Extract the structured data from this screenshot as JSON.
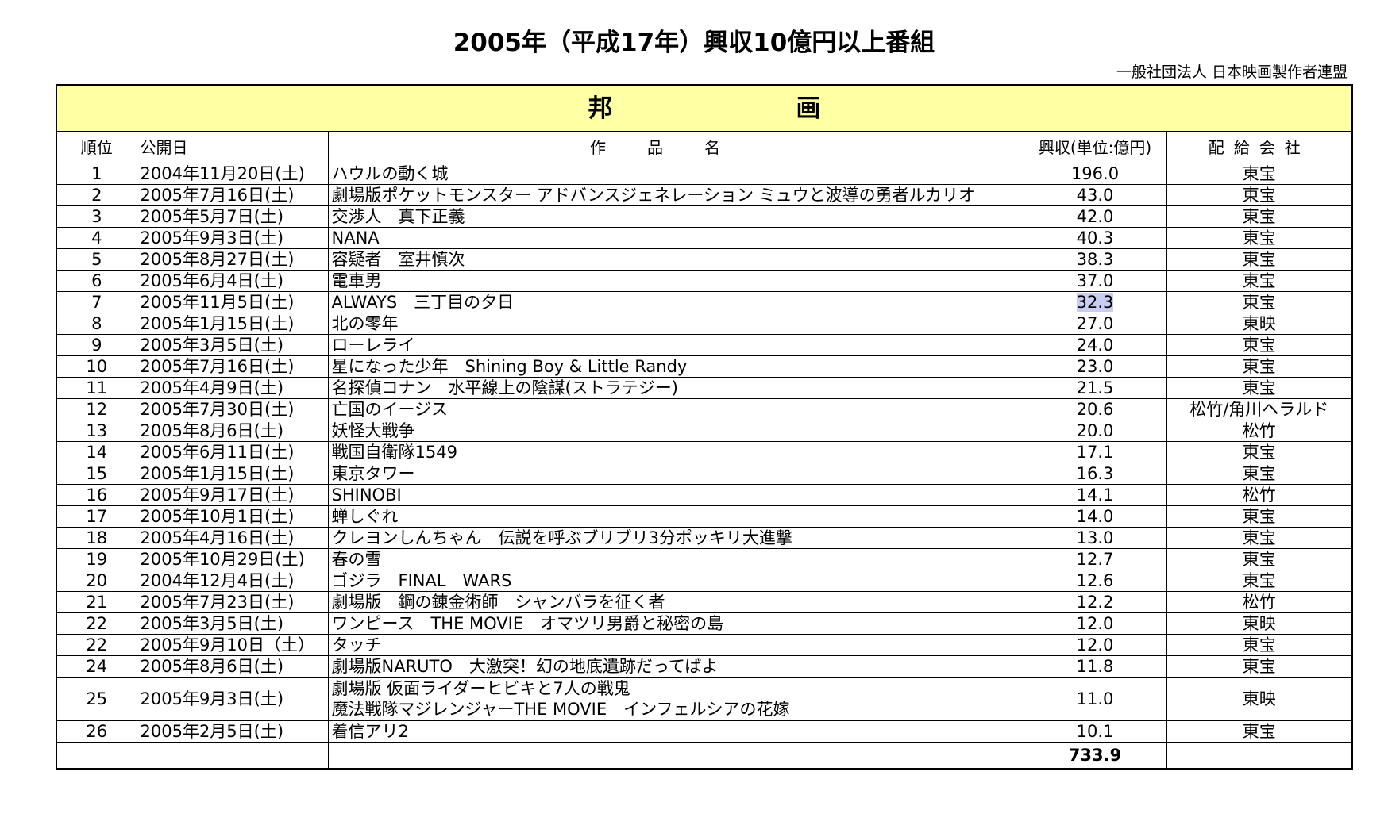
{
  "title": "2005年（平成17年）興収10億円以上番組",
  "organization": "一般社団法人 日本映画製作者連盟",
  "section": "邦　画",
  "headers": {
    "rank": "順位",
    "date": "公開日",
    "work": "作品名",
    "revenue": "興収(単位:億円)",
    "distributor": "配給会社"
  },
  "rows": [
    {
      "rank": "1",
      "date": "2004年11月20日(土)",
      "lines": [
        "ハウルの動く城"
      ],
      "revenue": "196.0",
      "distributor": "東宝"
    },
    {
      "rank": "2",
      "date": "2005年7月16日(土)",
      "lines": [
        "劇場版ポケットモンスター アドバンスジェネレーション ミュウと波導の勇者ルカリオ"
      ],
      "revenue": "43.0",
      "distributor": "東宝"
    },
    {
      "rank": "3",
      "date": "2005年5月7日(土)",
      "lines": [
        "交渉人　真下正義"
      ],
      "revenue": "42.0",
      "distributor": "東宝"
    },
    {
      "rank": "4",
      "date": "2005年9月3日(土)",
      "lines": [
        "NANA"
      ],
      "revenue": "40.3",
      "distributor": "東宝"
    },
    {
      "rank": "5",
      "date": "2005年8月27日(土)",
      "lines": [
        "容疑者　室井慎次"
      ],
      "revenue": "38.3",
      "distributor": "東宝"
    },
    {
      "rank": "6",
      "date": "2005年6月4日(土)",
      "lines": [
        "電車男"
      ],
      "revenue": "37.0",
      "distributor": "東宝"
    },
    {
      "rank": "7",
      "date": "2005年11月5日(土)",
      "lines": [
        "ALWAYS　三丁目の夕日"
      ],
      "revenue": "32.3",
      "distributor": "東宝",
      "highlight": true
    },
    {
      "rank": "8",
      "date": "2005年1月15日(土)",
      "lines": [
        "北の零年"
      ],
      "revenue": "27.0",
      "distributor": "東映"
    },
    {
      "rank": "9",
      "date": "2005年3月5日(土)",
      "lines": [
        "ローレライ"
      ],
      "revenue": "24.0",
      "distributor": "東宝"
    },
    {
      "rank": "10",
      "date": "2005年7月16日(土)",
      "lines": [
        "星になった少年　Shining Boy & Little Randy"
      ],
      "revenue": "23.0",
      "distributor": "東宝"
    },
    {
      "rank": "11",
      "date": "2005年4月9日(土)",
      "lines": [
        "名探偵コナン　水平線上の陰謀(ストラテジー)"
      ],
      "revenue": "21.5",
      "distributor": "東宝"
    },
    {
      "rank": "12",
      "date": "2005年7月30日(土)",
      "lines": [
        "亡国のイージス"
      ],
      "revenue": "20.6",
      "distributor": "松竹/角川ヘラルド"
    },
    {
      "rank": "13",
      "date": "2005年8月6日(土)",
      "lines": [
        "妖怪大戦争"
      ],
      "revenue": "20.0",
      "distributor": "松竹"
    },
    {
      "rank": "14",
      "date": "2005年6月11日(土)",
      "lines": [
        "戦国自衛隊1549"
      ],
      "revenue": "17.1",
      "distributor": "東宝"
    },
    {
      "rank": "15",
      "date": "2005年1月15日(土)",
      "lines": [
        "東京タワー"
      ],
      "revenue": "16.3",
      "distributor": "東宝"
    },
    {
      "rank": "16",
      "date": "2005年9月17日(土)",
      "lines": [
        "SHINOBI"
      ],
      "revenue": "14.1",
      "distributor": "松竹"
    },
    {
      "rank": "17",
      "date": "2005年10月1日(土)",
      "lines": [
        "蝉しぐれ"
      ],
      "revenue": "14.0",
      "distributor": "東宝"
    },
    {
      "rank": "18",
      "date": "2005年4月16日(土)",
      "lines": [
        "クレヨンしんちゃん　伝説を呼ぶブリブリ3分ポッキリ大進撃"
      ],
      "revenue": "13.0",
      "distributor": "東宝"
    },
    {
      "rank": "19",
      "date": "2005年10月29日(土)",
      "lines": [
        "春の雪"
      ],
      "revenue": "12.7",
      "distributor": "東宝"
    },
    {
      "rank": "20",
      "date": "2004年12月4日(土)",
      "lines": [
        "ゴジラ　FINAL　WARS"
      ],
      "revenue": "12.6",
      "distributor": "東宝"
    },
    {
      "rank": "21",
      "date": "2005年7月23日(土)",
      "lines": [
        "劇場版　鋼の錬金術師　シャンバラを征く者"
      ],
      "revenue": "12.2",
      "distributor": "松竹"
    },
    {
      "rank": "22",
      "date": "2005年3月5日(土)",
      "lines": [
        "ワンピース　THE MOVIE　オマツリ男爵と秘密の島"
      ],
      "revenue": "12.0",
      "distributor": "東映"
    },
    {
      "rank": "22",
      "date": "2005年9月10日（土）",
      "lines": [
        "タッチ"
      ],
      "revenue": "12.0",
      "distributor": "東宝"
    },
    {
      "rank": "24",
      "date": "2005年8月6日(土)",
      "lines": [
        "劇場版NARUTO　大激突！幻の地底遺跡だってばよ"
      ],
      "revenue": "11.8",
      "distributor": "東宝"
    },
    {
      "rank": "25",
      "date": "2005年9月3日(土)",
      "lines": [
        "劇場版 仮面ライダーヒビキと7人の戦鬼",
        "魔法戦隊マジレンジャーTHE MOVIE　インフェルシアの花嫁"
      ],
      "revenue": "11.0",
      "distributor": "東映"
    },
    {
      "rank": "26",
      "date": "2005年2月5日(土)",
      "lines": [
        "着信アリ2"
      ],
      "revenue": "10.1",
      "distributor": "東宝"
    }
  ],
  "total": "733.9"
}
